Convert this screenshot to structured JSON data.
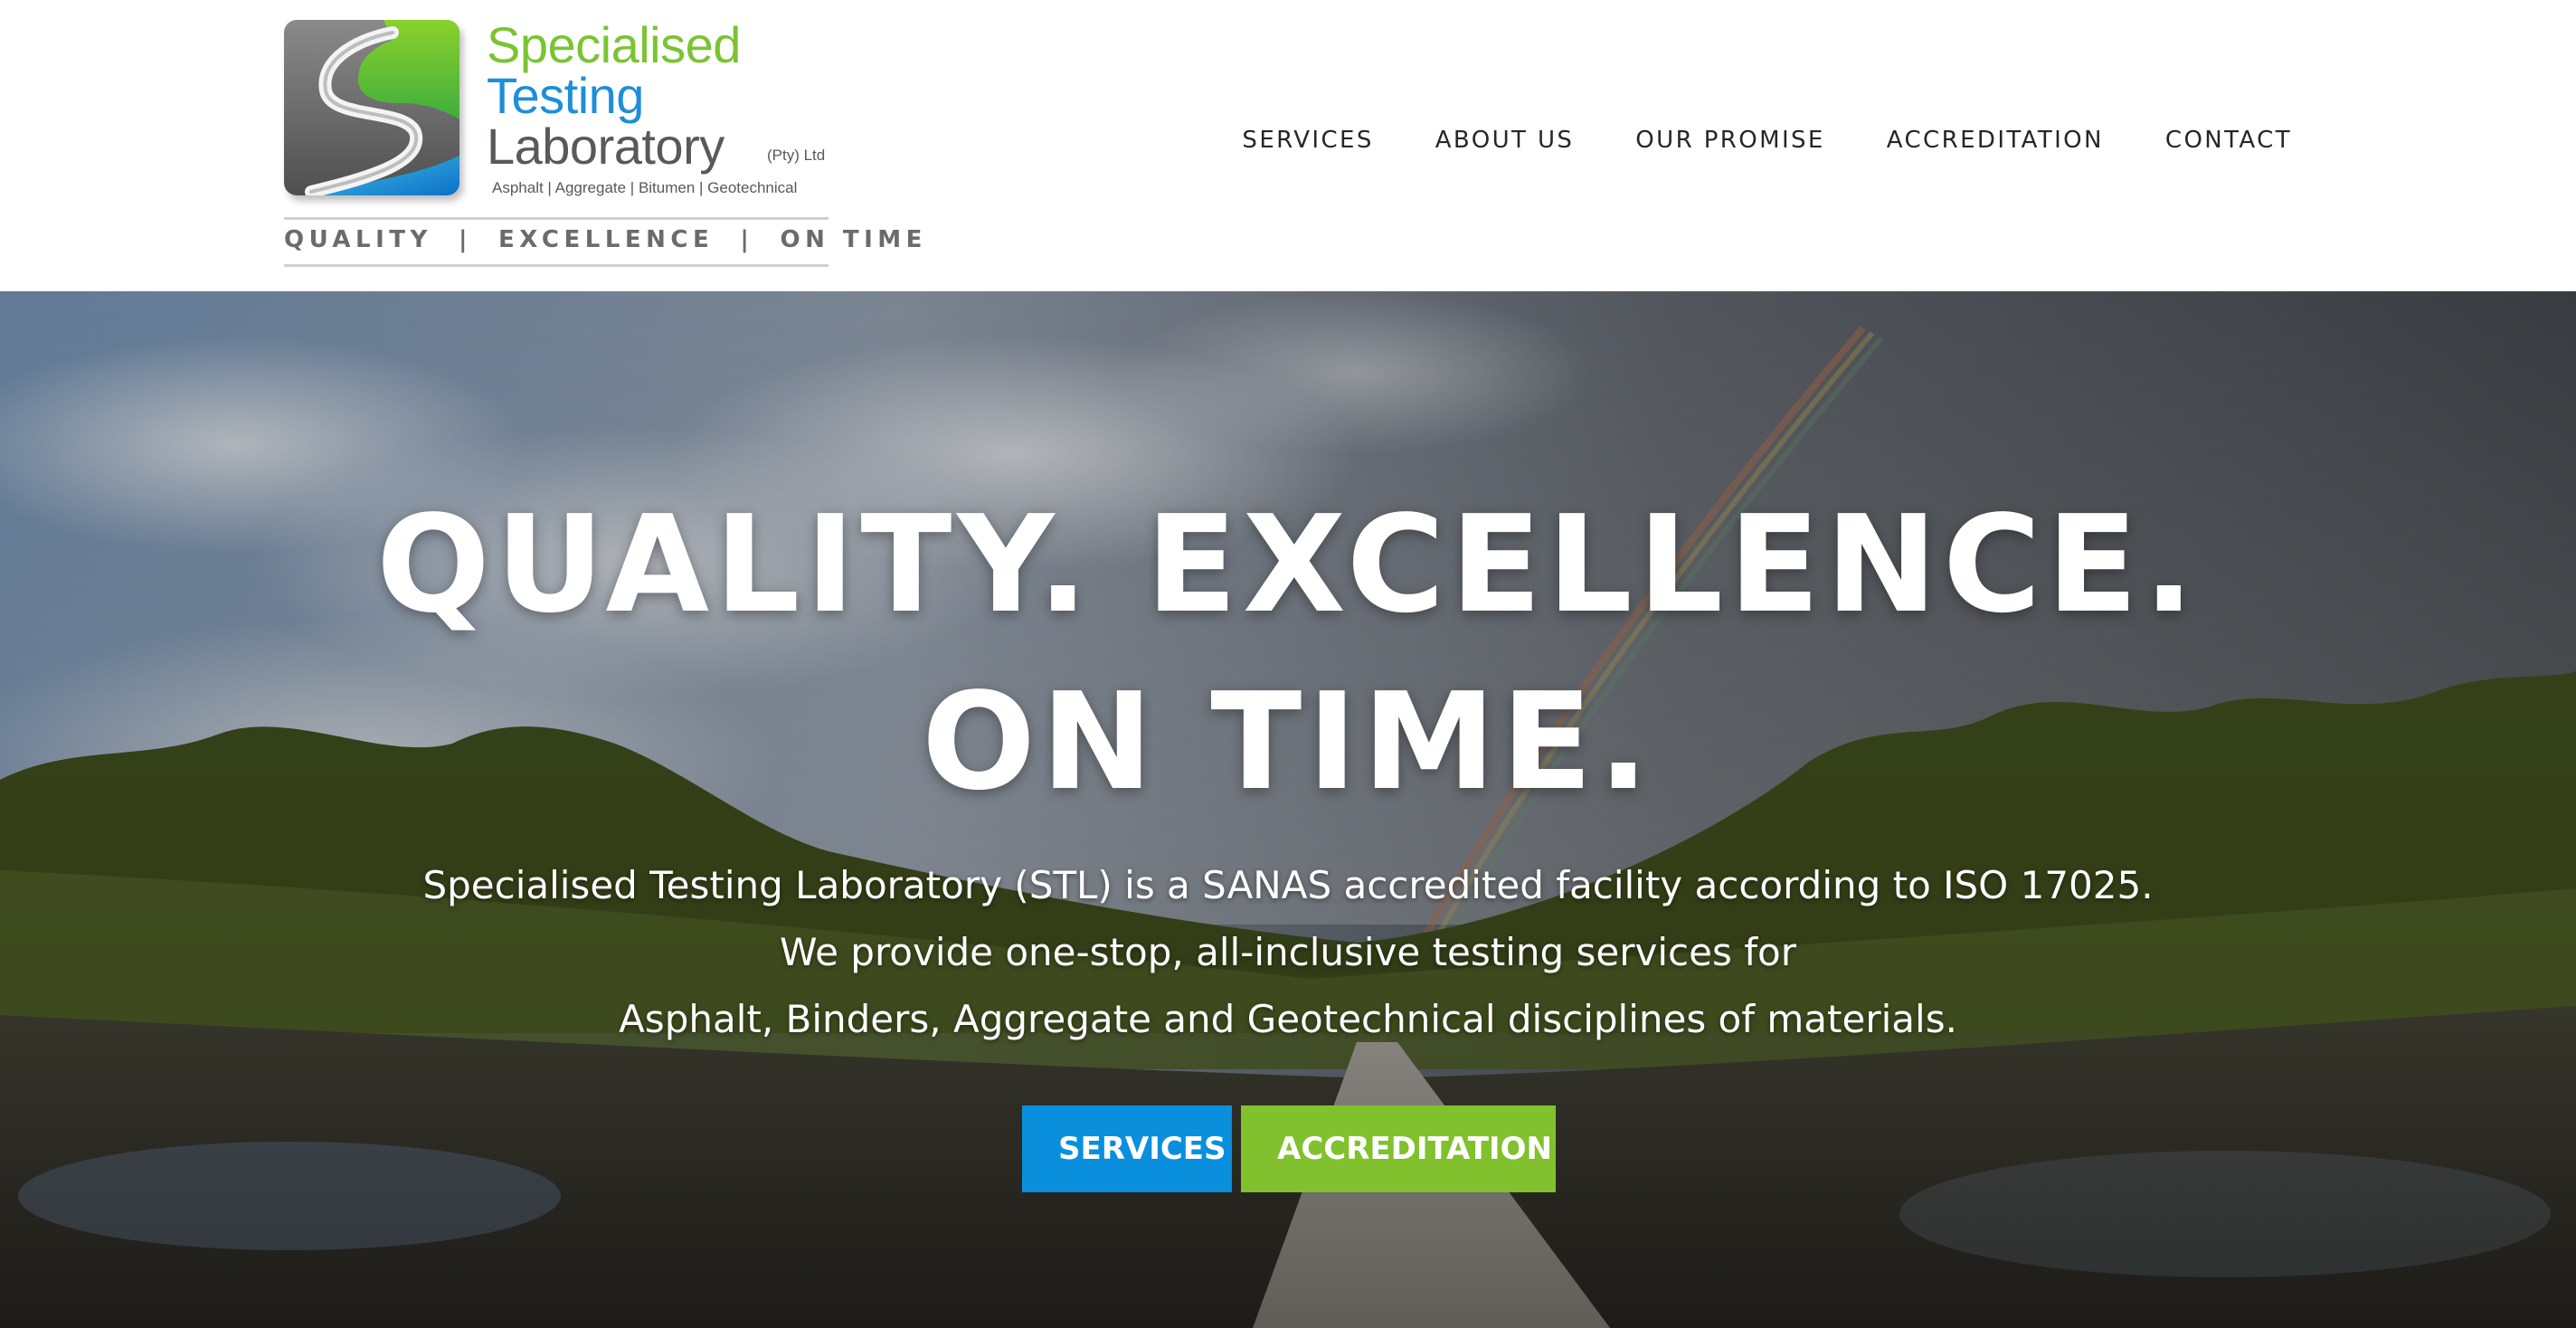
{
  "brand": {
    "line1": "Specialised",
    "line2": "Testing",
    "line3": "Laboratory",
    "suffix": "(Pty) Ltd",
    "disciplines": "Asphalt | Aggregate | Bitumen | Geotechnical",
    "tagline": "QUALITY  |  EXCELLENCE  |  ON TIME",
    "colors": {
      "green": "#7ac431",
      "blue": "#1d8fd8",
      "grey": "#58595b"
    }
  },
  "nav": {
    "items": [
      {
        "label": "SERVICES"
      },
      {
        "label": "ABOUT US"
      },
      {
        "label": "OUR PROMISE"
      },
      {
        "label": "ACCREDITATION"
      },
      {
        "label": "CONTACT"
      }
    ]
  },
  "hero": {
    "headline_line1": "QUALITY. EXCELLENCE.",
    "headline_line2": "ON TIME.",
    "copy_line1": "Specialised Testing Laboratory (STL) is a SANAS accredited facility according to ISO 17025.",
    "copy_line2": "We provide one-stop, all-inclusive testing services for",
    "copy_line3": "Asphalt, Binders, Aggregate and Geotechnical disciplines of materials.",
    "buttons": [
      {
        "label": "SERVICES",
        "color": "#0a8fdd"
      },
      {
        "label": "ACCREDITATION",
        "color": "#80c12d"
      }
    ]
  }
}
